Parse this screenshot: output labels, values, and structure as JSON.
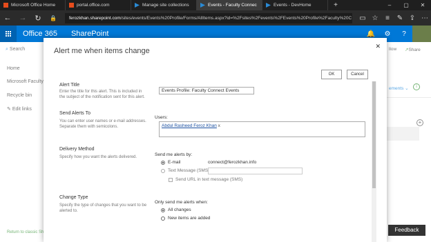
{
  "browser": {
    "tabs": [
      {
        "label": "Microsoft Office Home",
        "active": false
      },
      {
        "label": "portal.office.com",
        "active": false
      },
      {
        "label": "Manage site collections",
        "active": false
      },
      {
        "label": "Events - Faculty Connec",
        "active": true
      },
      {
        "label": "Events - DevHome",
        "active": false
      }
    ],
    "url_domain": "ferozkhan.sharepoint.com",
    "url_path": "/sites/events/Events%20Profile/Forms/AllItems.aspx?id=%2Fsites%2Fevents%2FEvents%20Profile%2Faculty%20C"
  },
  "suite": {
    "brand": "Office 365",
    "app": "SharePoint"
  },
  "page": {
    "search_label": "Search",
    "nav": [
      "Home",
      "Microsoft Faculty",
      "Recycle bin",
      "Edit links"
    ],
    "classic_link": "Return to classic SharePoint",
    "right_follow": "llow",
    "right_share": "Share",
    "right_elements": "ements",
    "feedback": "Feedback"
  },
  "dialog": {
    "title": "Alert me when items change",
    "ok": "OK",
    "cancel": "Cancel",
    "alert_title": {
      "heading": "Alert Title",
      "desc": "Enter the title for this alert. This is included in the subject of the notification sent for this alert.",
      "value": "Events Profile: Faculty Connect Events"
    },
    "send_to": {
      "heading": "Send Alerts To",
      "desc": "You can enter user names or e-mail addresses. Separate them with semicolons.",
      "users_label": "Users:",
      "user": "Abdul Rasheed Feroz Khan",
      "remove": "x"
    },
    "delivery": {
      "heading": "Delivery Method",
      "desc": "Specify how you want the alerts delivered.",
      "send_by_label": "Send me alerts by:",
      "email_label": "E-mail",
      "email_value": "connect@ferozkhan.info",
      "sms_label": "Text Message (SMS)",
      "url_in_sms": "Send URL in text message (SMS)"
    },
    "change_type": {
      "heading": "Change Type",
      "desc": "Specify the type of changes that you want to be alerted to.",
      "only_label": "Only send me alerts when:",
      "all_changes": "All changes",
      "new_items": "New items are added"
    }
  }
}
